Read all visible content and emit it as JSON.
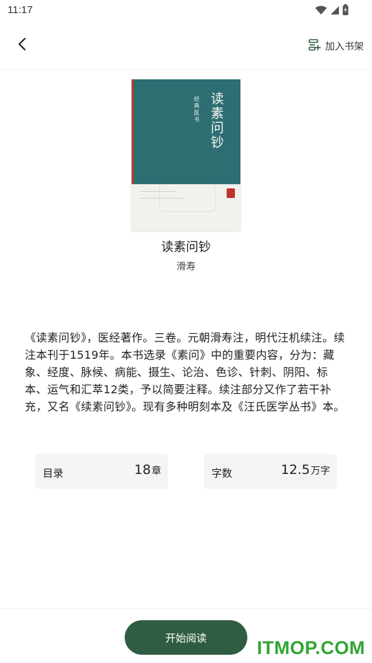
{
  "status_bar": {
    "time": "11:17",
    "icons": [
      "wifi-icon",
      "signal-icon",
      "battery-icon"
    ]
  },
  "header": {
    "back_icon": "back-arrow-icon",
    "shelf_icon": "add-to-shelf-icon",
    "shelf_label": "加入书架"
  },
  "book": {
    "cover": {
      "title": "读素问钞",
      "series": "经典医书"
    },
    "title": "读素问钞",
    "author": "滑寿",
    "description": "《读素问钞》，医经著作。三卷。元朝滑寿注，明代汪机续注。续注本刊于1519年。本书选录《素问》中的重要内容，分为：藏象、经度、脉候、病能、摄生、论治、色诊、针刺、阴阳、标本、运气和汇萃12类，予以简要注释。续注部分又作了若干补充，又名《续素问钞》。现有多种明刻本及《汪氏医学丛书》本。"
  },
  "stats": {
    "chapters": {
      "label": "目录",
      "value": "18",
      "unit": "章"
    },
    "words": {
      "label": "字数",
      "value": "12.5",
      "unit": "万字"
    }
  },
  "actions": {
    "start_label": "开始阅读"
  },
  "watermark": {
    "text": "ITMOP.COM"
  },
  "colors": {
    "accent": "#2f5d43",
    "cover_teal": "#2d6e73",
    "watermark_green": "#2fa432"
  }
}
